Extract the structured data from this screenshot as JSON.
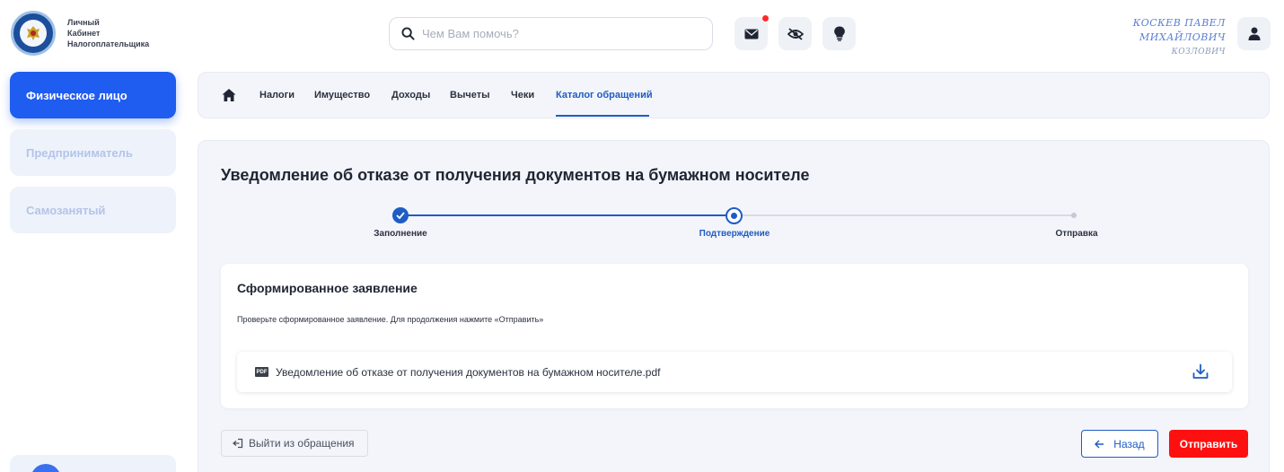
{
  "header": {
    "logo_lines": [
      "Личный",
      "Кабинет",
      "Налогоплательщика"
    ],
    "search_placeholder": "Чем Вам помочь?",
    "user_name_lines": [
      "КОСКЕВ ПАВЕЛ",
      "МИХАЙЛОВИЧ",
      "КОЗЛОВИЧ"
    ]
  },
  "sidebar": {
    "items": [
      {
        "label": "Физическое лицо",
        "active": true
      },
      {
        "label": "Предприниматель",
        "active": false
      },
      {
        "label": "Самозанятый",
        "active": false
      }
    ]
  },
  "tabs": {
    "items": [
      {
        "label": "Налоги"
      },
      {
        "label": "Имущество"
      },
      {
        "label": "Доходы"
      },
      {
        "label": "Вычеты"
      },
      {
        "label": "Чеки"
      },
      {
        "label": "Каталог обращений",
        "active": true
      }
    ]
  },
  "main": {
    "title": "Уведомление об отказе от получения документов на бумажном носителе",
    "steps": [
      {
        "label": "Заполнение",
        "state": "done"
      },
      {
        "label": "Подтверждение",
        "state": "current"
      },
      {
        "label": "Отправка",
        "state": "pending"
      }
    ],
    "card": {
      "title": "Сформированное заявление",
      "subtitle": "Проверьте сформированное заявление. Для продолжения нажмите «Отправить»",
      "file_type": "PDF",
      "file_name": "Уведомление об отказе от получения документов на бумажном носителе.pdf"
    },
    "buttons": {
      "exit": "Выйти из обращения",
      "back": "Назад",
      "send": "Отправить"
    }
  },
  "colors": {
    "accent": "#1f5cf0",
    "link": "#1f5cc4",
    "danger": "#ff1010",
    "notification": "#ff2a2a"
  }
}
